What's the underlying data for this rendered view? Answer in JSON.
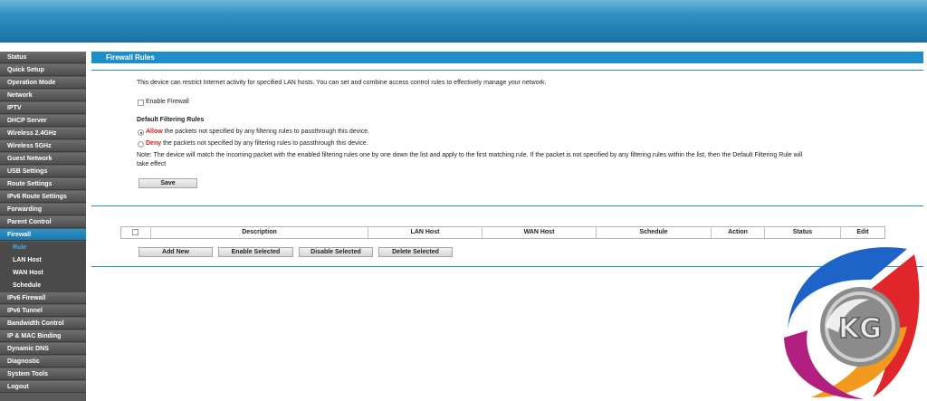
{
  "sidebar": {
    "items": [
      {
        "label": "Status"
      },
      {
        "label": "Quick Setup"
      },
      {
        "label": "Operation Mode"
      },
      {
        "label": "Network"
      },
      {
        "label": "IPTV"
      },
      {
        "label": "DHCP Server"
      },
      {
        "label": "Wireless 2.4GHz"
      },
      {
        "label": "Wireless 5GHz"
      },
      {
        "label": "Guest Network"
      },
      {
        "label": "USB Settings"
      },
      {
        "label": "Route Settings"
      },
      {
        "label": "IPv6 Route Settings"
      },
      {
        "label": "Forwarding"
      },
      {
        "label": "Parent Control"
      },
      {
        "label": "Firewall",
        "active": true
      }
    ],
    "subitems": [
      {
        "label": "Rule",
        "active": true
      },
      {
        "label": "LAN Host"
      },
      {
        "label": "WAN Host"
      },
      {
        "label": "Schedule"
      }
    ],
    "items_after": [
      {
        "label": "IPv6 Firewall"
      },
      {
        "label": "IPv6 Tunnel"
      },
      {
        "label": "Bandwidth Control"
      },
      {
        "label": "IP & MAC Binding"
      },
      {
        "label": "Dynamic DNS"
      },
      {
        "label": "Diagnostic"
      },
      {
        "label": "System Tools"
      },
      {
        "label": "Logout"
      }
    ]
  },
  "main": {
    "section_title": "Firewall Rules",
    "description": "This device can restrict Internet activity for specified LAN hosts. You can set and combine access control rules to effectively manage your network.",
    "enable_label": "Enable Firewall",
    "enable_checked": false,
    "default_rules_heading": "Default Filtering Rules",
    "allow_keyword": "Allow",
    "allow_text": "the packets not specified by any filtering rules to passthrough this device.",
    "allow_selected": true,
    "deny_keyword": "Deny",
    "deny_text": "the packets not specified by any filtering rules to passthrough this device.",
    "deny_selected": false,
    "note_line1": "Note: The device will match the incoming packet with the enabled filtering rules one by one down the list and apply to the first matching rule.  If the packet is not specified by any filtering rules within the list, then the Default Filtering Rule will",
    "note_line2": "take effect",
    "save_label": "Save"
  },
  "table": {
    "headers": [
      "Description",
      "LAN Host",
      "WAN Host",
      "Schedule",
      "Action",
      "Status",
      "Edit"
    ]
  },
  "actions": {
    "add_new": "Add New",
    "enable_selected": "Enable Selected",
    "disable_selected": "Disable Selected",
    "delete_selected": "Delete Selected"
  },
  "logo": {
    "text": "KG",
    "colors": {
      "blue": "#1e63c8",
      "red": "#e0262a",
      "orange": "#f29a1f",
      "magenta": "#b31f7f",
      "gray": "#8b8b8b"
    }
  },
  "theme": {
    "accent": "#1d8ec9",
    "sidebar_bg": "#5a5a5a",
    "active_sub": "#3fb0e8"
  }
}
